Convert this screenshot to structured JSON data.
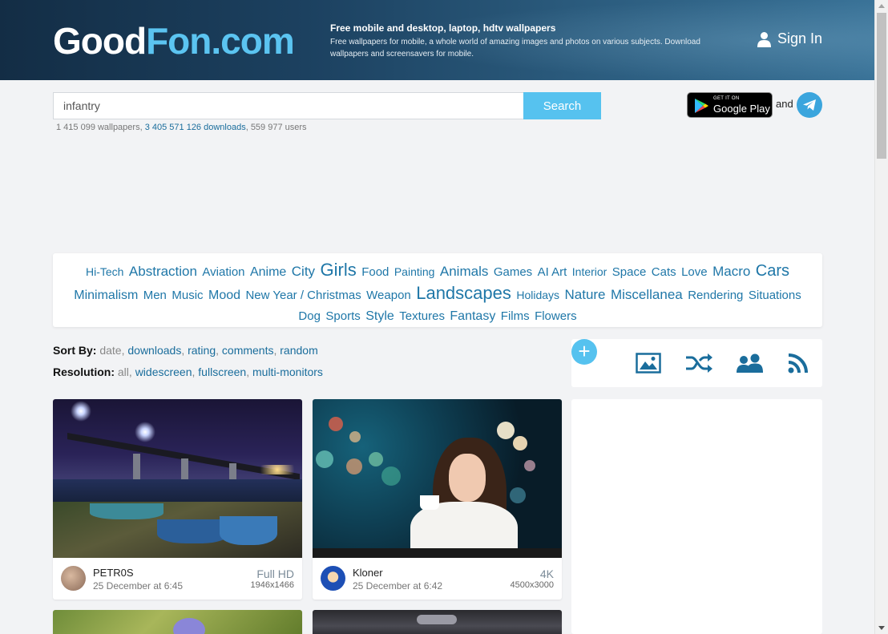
{
  "header": {
    "logo_part1": "Good",
    "logo_part2": "Fon.com",
    "tagline_title": "Free mobile and desktop, laptop, hdtv wallpapers",
    "tagline_text": "Free wallpapers for mobile, a whole world of amazing images and photos on various subjects. Download wallpapers and screensavers for mobile.",
    "signin_label": "Sign In"
  },
  "search": {
    "value": "infantry",
    "button_label": "Search"
  },
  "stats": {
    "wallpapers": "1 415 099 wallpapers,",
    "downloads": "3 405 571 126 downloads",
    "users": ", 559 977 users"
  },
  "apps": {
    "gplay_small": "GET IT ON",
    "gplay_big": "Google Play",
    "and_text": "and"
  },
  "categories": [
    {
      "label": "Hi-Tech",
      "size": "sz14"
    },
    {
      "label": "Abstraction",
      "size": "sz17"
    },
    {
      "label": "Aviation",
      "size": "sz15"
    },
    {
      "label": "Anime",
      "size": "sz16"
    },
    {
      "label": "City",
      "size": "sz17"
    },
    {
      "label": "Girls",
      "size": "sz22"
    },
    {
      "label": "Food",
      "size": "sz15"
    },
    {
      "label": "Painting",
      "size": "sz14"
    },
    {
      "label": "Animals",
      "size": "sz17"
    },
    {
      "label": "Games",
      "size": "sz15"
    },
    {
      "label": "AI Art",
      "size": "sz15"
    },
    {
      "label": "Interior",
      "size": "sz14"
    },
    {
      "label": "Space",
      "size": "sz15"
    },
    {
      "label": "Cats",
      "size": "sz15"
    },
    {
      "label": "Love",
      "size": "sz15"
    },
    {
      "label": "Macro",
      "size": "sz17"
    },
    {
      "label": "Cars",
      "size": "sz20"
    },
    {
      "label": "Minimalism",
      "size": "sz16"
    },
    {
      "label": "Men",
      "size": "sz15"
    },
    {
      "label": "Music",
      "size": "sz15"
    },
    {
      "label": "Mood",
      "size": "sz16"
    },
    {
      "label": "New Year / Christmas",
      "size": "sz15"
    },
    {
      "label": "Weapon",
      "size": "sz15"
    },
    {
      "label": "Landscapes",
      "size": "sz22"
    },
    {
      "label": "Holidays",
      "size": "sz14"
    },
    {
      "label": "Nature",
      "size": "sz17"
    },
    {
      "label": "Miscellanea",
      "size": "sz17"
    },
    {
      "label": "Rendering",
      "size": "sz15"
    },
    {
      "label": "Situations",
      "size": "sz15"
    },
    {
      "label": "Dog",
      "size": "sz15"
    },
    {
      "label": "Sports",
      "size": "sz15"
    },
    {
      "label": "Style",
      "size": "sz16"
    },
    {
      "label": "Textures",
      "size": "sz15"
    },
    {
      "label": "Fantasy",
      "size": "sz16"
    },
    {
      "label": "Films",
      "size": "sz15"
    },
    {
      "label": "Flowers",
      "size": "sz15"
    }
  ],
  "sort": {
    "label": "Sort By:",
    "current": "date",
    "options": [
      "downloads",
      "rating",
      "comments",
      "random"
    ]
  },
  "resolution": {
    "label": "Resolution:",
    "current": "all",
    "options": [
      "widescreen",
      "fullscreen",
      "multi-monitors"
    ]
  },
  "toolbar": {
    "add_glyph": "+",
    "icons": [
      "add-icon",
      "image-icon",
      "shuffle-icon",
      "users-icon",
      "rss-icon"
    ]
  },
  "cards": [
    {
      "author": "PETR0S",
      "date": "25 December at 6:45",
      "quality": "Full HD",
      "resolution": "1946x1466"
    },
    {
      "author": "Kloner",
      "date": "25 December at 6:42",
      "quality": "4K",
      "resolution": "4500x3000"
    }
  ],
  "colors": {
    "accent": "#56c2ef",
    "link": "#1f77a8",
    "header_dark": "#132d45"
  }
}
